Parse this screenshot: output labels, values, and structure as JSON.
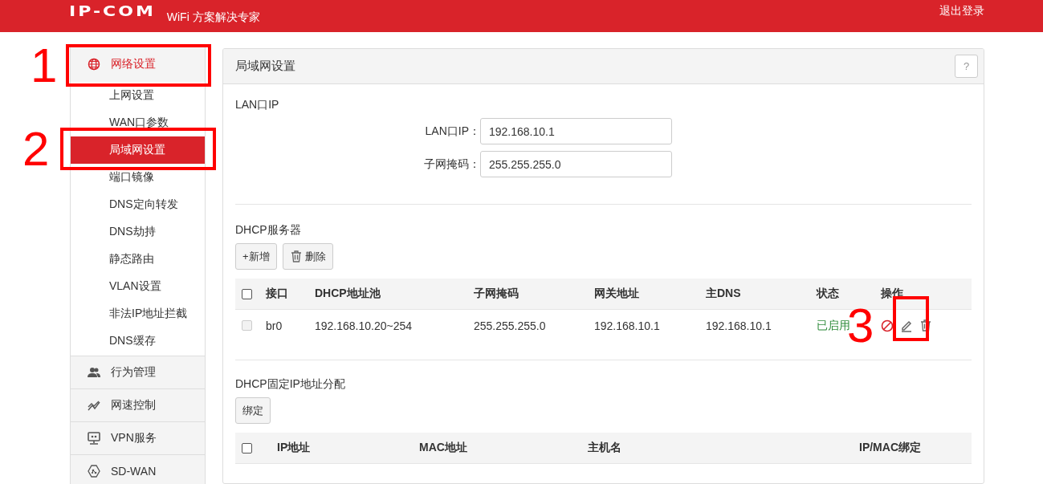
{
  "header": {
    "logo": "IP-COM",
    "tagline": "WiFi 方案解决专家",
    "logout": "退出登录"
  },
  "sidebar": {
    "items": [
      {
        "label": "网络设置",
        "selected": true,
        "expanded": true,
        "children": [
          {
            "label": "上网设置",
            "selected": false
          },
          {
            "label": "WAN口参数",
            "selected": false
          },
          {
            "label": "局域网设置",
            "selected": true
          },
          {
            "label": "端口镜像",
            "selected": false
          },
          {
            "label": "DNS定向转发",
            "selected": false
          },
          {
            "label": "DNS劫持",
            "selected": false
          },
          {
            "label": "静态路由",
            "selected": false
          },
          {
            "label": "VLAN设置",
            "selected": false
          },
          {
            "label": "非法IP地址拦截",
            "selected": false
          },
          {
            "label": "DNS缓存",
            "selected": false
          }
        ]
      },
      {
        "label": "行为管理",
        "selected": false,
        "expanded": false
      },
      {
        "label": "网速控制",
        "selected": false,
        "expanded": false
      },
      {
        "label": "VPN服务",
        "selected": false,
        "expanded": false
      },
      {
        "label": "SD-WAN",
        "selected": false,
        "expanded": false
      }
    ]
  },
  "panel": {
    "title": "局域网设置",
    "help": "?",
    "lan": {
      "title": "LAN口IP",
      "fields": [
        {
          "label": "LAN口IP：",
          "value": "192.168.10.1"
        },
        {
          "label": "子网掩码：",
          "value": "255.255.255.0"
        }
      ]
    },
    "dhcp": {
      "title": "DHCP服务器",
      "buttons": [
        {
          "label": "+新增",
          "kind": "plain"
        },
        {
          "label": "删除",
          "kind": "trash"
        }
      ],
      "table": {
        "header_checked": false,
        "columns": [
          "接口",
          "DHCP地址池",
          "子网掩码",
          "网关地址",
          "主DNS",
          "状态",
          "操作"
        ],
        "rows": [
          {
            "checked": false,
            "disabled": true,
            "cells": [
              "br0",
              "192.168.10.20~254",
              "255.255.255.0",
              "192.168.10.1",
              "192.168.10.1"
            ],
            "status": "已启用",
            "enabled": true
          }
        ]
      }
    },
    "static": {
      "title": "DHCP固定IP地址分配",
      "buttons": [
        {
          "label": "绑定",
          "kind": "plain"
        }
      ],
      "table": {
        "header_checked": false,
        "columns": [
          "IP地址",
          "MAC地址",
          "主机名",
          "IP/MAC绑定"
        ]
      }
    }
  },
  "annotations": [
    {
      "label": "1"
    },
    {
      "label": "2"
    },
    {
      "label": "3"
    }
  ]
}
